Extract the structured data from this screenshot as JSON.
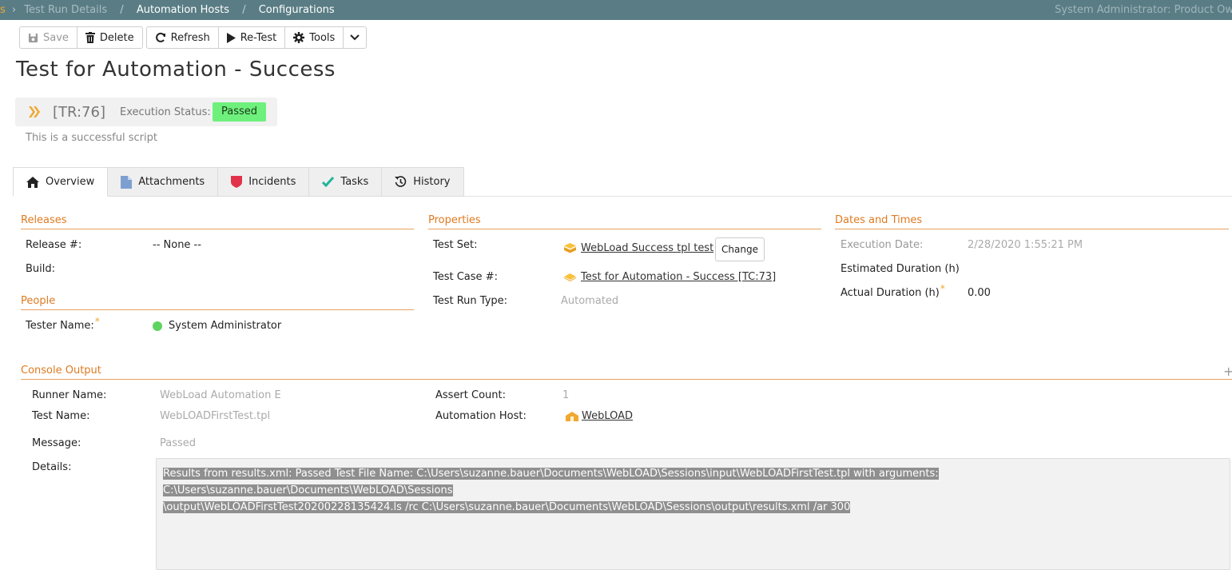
{
  "topbar": {
    "fragment": "s",
    "crumb_faded": "Test Run Details",
    "crumb_1": "Automation Hosts",
    "crumb_2": "Configurations",
    "user": "System Administrator: Product Ow"
  },
  "toolbar": {
    "save": "Save",
    "delete": "Delete",
    "refresh": "Refresh",
    "retest": "Re-Test",
    "tools": "Tools"
  },
  "page": {
    "title": "Test for Automation - Success",
    "id": "[TR:76]",
    "execution_status_label": "Execution Status:",
    "execution_status": "Passed",
    "description": "This is a successful script"
  },
  "tabs": [
    {
      "label": "Overview"
    },
    {
      "label": "Attachments"
    },
    {
      "label": "Incidents"
    },
    {
      "label": "Tasks"
    },
    {
      "label": "History"
    }
  ],
  "releases": {
    "heading": "Releases",
    "release_label": "Release #:",
    "release_value": "-- None --",
    "build_label": "Build:"
  },
  "people": {
    "heading": "People",
    "tester_label": "Tester Name:",
    "tester_value": "System Administrator"
  },
  "properties": {
    "heading": "Properties",
    "test_set_label": "Test Set:",
    "test_set_value": "WebLoad Success tpl test",
    "change_label": "Change",
    "test_case_label": "Test Case #:",
    "test_case_value": "Test for Automation - Success [TC:73]",
    "run_type_label": "Test Run Type:",
    "run_type_value": "Automated"
  },
  "dates": {
    "heading": "Dates and Times",
    "exec_date_label": "Execution Date:",
    "exec_date_value": "2/28/2020 1:55:21 PM",
    "est_duration_label": "Estimated Duration (h)",
    "act_duration_label": "Actual Duration (h)",
    "act_duration_value": "0.00"
  },
  "console": {
    "heading": "Console Output",
    "runner_label": "Runner Name:",
    "runner_value": "WebLoad Automation E",
    "test_name_label": "Test Name:",
    "test_name_value": "WebLOADFirstTest.tpl",
    "message_label": "Message:",
    "message_value": "Passed",
    "details_label": "Details:",
    "assert_label": "Assert Count:",
    "assert_value": "1",
    "host_label": "Automation Host:",
    "host_value": "WebLOAD",
    "details_line_1": "Results from results.xml: Passed Test File Name: C:\\Users\\suzanne.bauer\\Documents\\WebLOAD\\Sessions\\input\\WebLOADFirstTest.tpl with arguments: C:\\Users\\suzanne.bauer\\Documents\\WebLOAD\\Sessions",
    "details_line_2": "\\output\\WebLOADFirstTest20200228135424.ls /rc C:\\Users\\suzanne.bauer\\Documents\\WebLOAD\\Sessions\\output\\results.xml /ar 300"
  },
  "colors": {
    "topbar": "#5a7d85",
    "accent_orange": "#e07a20",
    "status_passed": "#6ef07c"
  },
  "icons": {
    "save": "floppy-icon",
    "delete": "trash-icon",
    "refresh": "refresh-icon",
    "retest": "play-icon",
    "tools": "gear-icon",
    "more": "chevron-down-icon"
  }
}
